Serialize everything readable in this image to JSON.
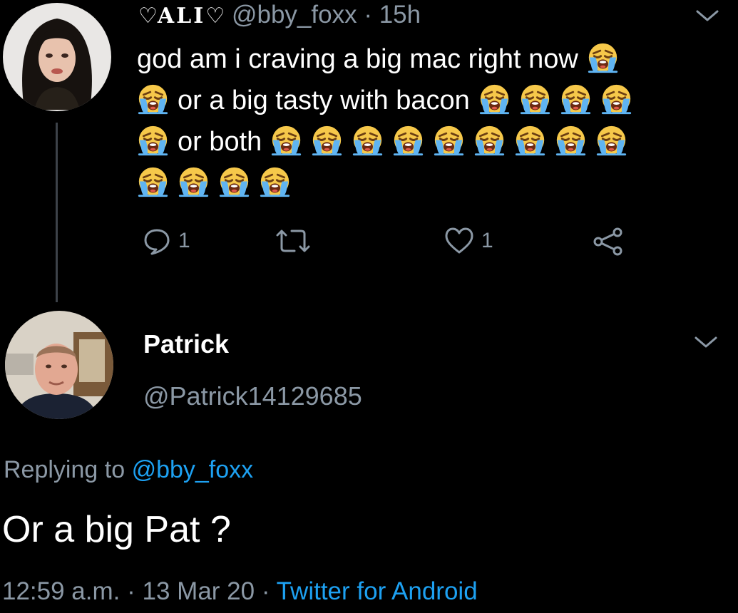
{
  "tweet": {
    "heart_left": "♡",
    "display_name": "ALI",
    "heart_right": "♡",
    "handle": "@bby_foxx",
    "separator": "·",
    "time": "15h",
    "lines": [
      {
        "text": "god am i craving a big mac right now",
        "emoji_before": 0,
        "emoji_after": 1
      },
      {
        "text": "or a big tasty with bacon",
        "emoji_before": 1,
        "emoji_after": 4
      },
      {
        "text": "or both",
        "emoji_before": 1,
        "emoji_after": 9
      },
      {
        "text": "",
        "emoji_before": 4,
        "emoji_after": 0
      }
    ],
    "emoji_name": "loudly-crying-face-icon",
    "reply_count": "1",
    "like_count": "1"
  },
  "reply": {
    "name": "Patrick",
    "handle": "@Patrick14129685",
    "replying_prefix": "Replying to",
    "replying_handle": "@bby_foxx",
    "text": "Or a big Pat ?",
    "time": "12:59 a.m.",
    "date": "13 Mar 20",
    "separator": "·",
    "source": "Twitter for Android"
  },
  "colors": {
    "background": "#000000",
    "secondary_text": "#8b98a5",
    "link": "#1da1f2",
    "thread_line": "#3d4249"
  }
}
